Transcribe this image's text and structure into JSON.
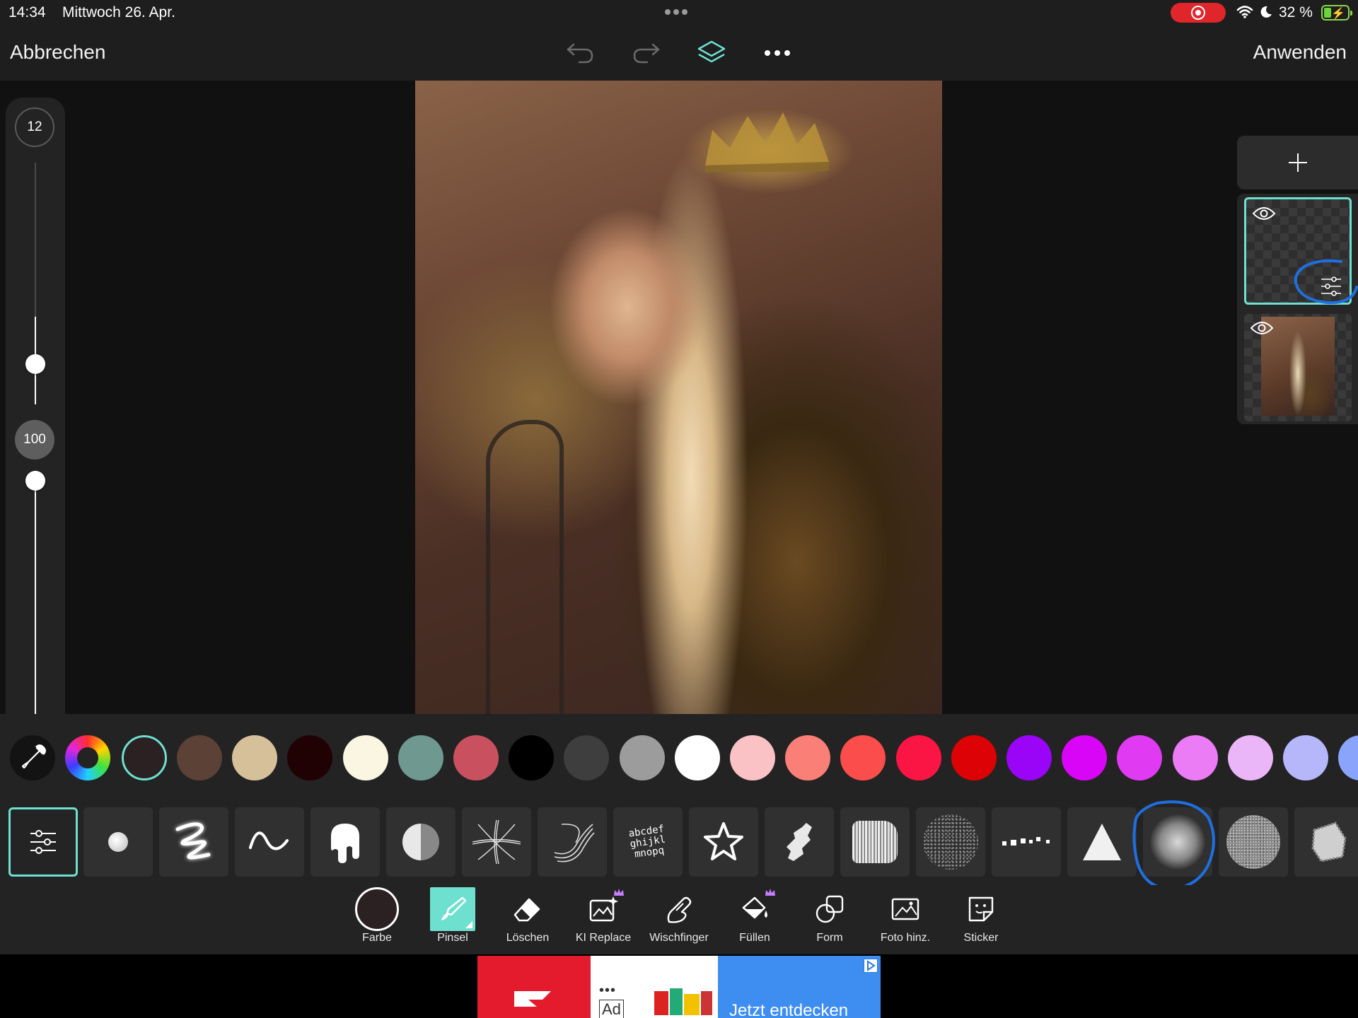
{
  "status_bar": {
    "time": "14:34",
    "date": "Mittwoch 26. Apr.",
    "battery": "32 %",
    "battery_level": 0.32,
    "icons": [
      "screen-record-icon",
      "wifi-icon",
      "moon-icon",
      "battery-charging-icon"
    ]
  },
  "toolbar": {
    "cancel_label": "Abbrechen",
    "apply_label": "Anwenden",
    "icons": [
      "undo-icon",
      "redo-icon",
      "layers-icon",
      "more-icon"
    ]
  },
  "sliders": {
    "brush_size": "12",
    "opacity": "100"
  },
  "layers": {
    "add_icon": "plus-icon",
    "items": [
      {
        "name": "layer-1",
        "selected": true,
        "visibility_icon": "eye-icon",
        "settings_icon": "sliders-icon"
      },
      {
        "name": "layer-2",
        "selected": false,
        "visibility_icon": "eye-icon"
      }
    ],
    "accent": "#6ee0cf"
  },
  "colors": {
    "picker_icon": "eyedropper-icon",
    "wheel_icon": "color-wheel-icon",
    "selected": "#2b2022",
    "swatches": [
      "#5c4136",
      "#d6c09a",
      "#200204",
      "#fbf6e2",
      "#6f9990",
      "#c9505f",
      "#000000",
      "#3e3e3e",
      "#9c9c9c",
      "#ffffff",
      "#fbc2c6",
      "#fa7f76",
      "#fb4d4b",
      "#fa1544",
      "#dd0205",
      "#9a04f7",
      "#d805f6",
      "#e03af3",
      "#eb7cf6",
      "#ebb6f7",
      "#b6b7fb",
      "#8ba4fb"
    ]
  },
  "brushes": {
    "items": [
      "brush-settings-icon",
      "round-brush-icon",
      "neon-brush-icon",
      "wave-brush-icon",
      "drip-brush-icon",
      "half-tone-brush-icon",
      "cross-brush-icon",
      "ribbon-brush-icon",
      "text-brush-icon",
      "star-brush-icon",
      "rough-brush-icon",
      "dry-brush-icon",
      "spray-brush-icon",
      "dots-brush-icon",
      "triangle-brush-icon",
      "soft-brush-icon",
      "noise-brush-icon",
      "chalk-brush-icon"
    ],
    "text_brush_sample": "abcdef ghijkl mnopq",
    "selected_index": 0,
    "highlighted_index": 15
  },
  "tools": [
    {
      "label": "Farbe",
      "icon": "color-circle-icon"
    },
    {
      "label": "Pinsel",
      "icon": "brush-icon",
      "active": true
    },
    {
      "label": "Löschen",
      "icon": "eraser-icon"
    },
    {
      "label": "KI Replace",
      "icon": "ai-replace-icon",
      "premium": true
    },
    {
      "label": "Wischfinger",
      "icon": "smudge-finger-icon"
    },
    {
      "label": "Füllen",
      "icon": "fill-bucket-icon",
      "premium": true
    },
    {
      "label": "Form",
      "icon": "shape-icon"
    },
    {
      "label": "Foto hinz.",
      "icon": "add-photo-icon"
    },
    {
      "label": "Sticker",
      "icon": "sticker-icon"
    }
  ],
  "ad": {
    "cta": "Jetzt entdecken",
    "label": "Ad",
    "dots": "•••",
    "choices_icon": "ad-choices-icon"
  }
}
